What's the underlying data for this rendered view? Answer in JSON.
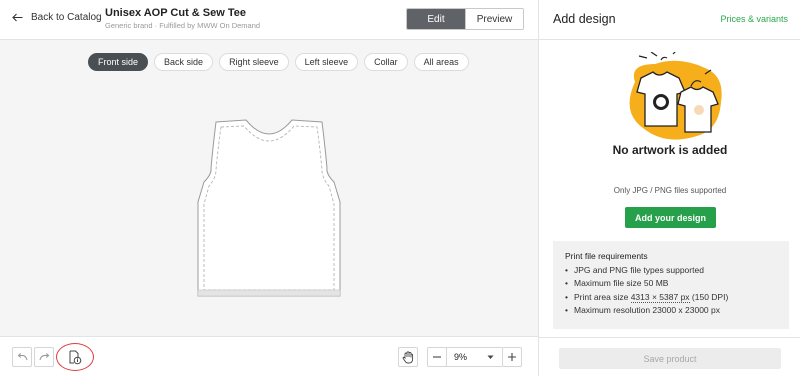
{
  "header": {
    "back_label": "Back to Catalog",
    "product_title": "Unisex AOP Cut & Sew Tee",
    "product_subtitle": "Generic brand · Fulfilled by MWW On Demand",
    "edit_label": "Edit",
    "preview_label": "Preview"
  },
  "side_tabs": [
    "Front side",
    "Back side",
    "Right sleeve",
    "Left sleeve",
    "Collar",
    "All areas"
  ],
  "active_side_tab": "Front side",
  "toolbar": {
    "zoom_value": "9%",
    "icons": [
      "undo-icon",
      "redo-icon",
      "file-info-icon",
      "hand-icon",
      "minus-icon",
      "chevron-down-icon",
      "plus-icon"
    ]
  },
  "panel": {
    "title": "Add design",
    "prices_link": "Prices & variants",
    "empty_title": "No artwork is added",
    "empty_subtitle": "Only JPG / PNG files supported",
    "add_button": "Add your design",
    "requirements_title": "Print file requirements",
    "requirements": [
      "JPG and PNG file types supported",
      "Maximum file size 50 MB",
      "Print area size ",
      "Maximum resolution 23000 x 23000 px"
    ],
    "print_area_value": "4313 × 5387 px",
    "print_area_dpi": " (150 DPI)",
    "save_button": "Save product"
  },
  "colors": {
    "accent_green": "#26a04a",
    "link_green": "#2aa84a",
    "illustration_yellow": "#f6ae1b",
    "active_tab": "#4a4f54",
    "highlight_red": "#e03b3b"
  }
}
